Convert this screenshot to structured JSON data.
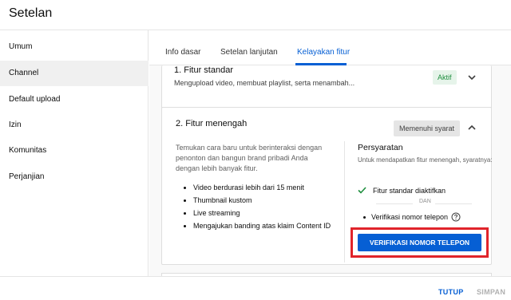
{
  "header": {
    "title": "Setelan"
  },
  "sidebar": {
    "items": [
      {
        "label": "Umum"
      },
      {
        "label": "Channel"
      },
      {
        "label": "Default upload"
      },
      {
        "label": "Izin"
      },
      {
        "label": "Komunitas"
      },
      {
        "label": "Perjanjian"
      }
    ],
    "active": "Channel"
  },
  "tabs": [
    {
      "label": "Info dasar"
    },
    {
      "label": "Setelan lanjutan"
    },
    {
      "label": "Kelayakan fitur"
    }
  ],
  "active_tab": "Kelayakan fitur",
  "card1": {
    "title": "1. Fitur standar",
    "subtitle": "Mengupload video, membuat playlist, serta menambah...",
    "badge": "Aktif"
  },
  "card2": {
    "title": "2. Fitur menengah",
    "badge": "Memenuhi syarat",
    "description": "Temukan cara baru untuk berinteraksi dengan penonton dan bangun brand pribadi Anda dengan lebih banyak fitur.",
    "features": [
      "Video berdurasi lebih dari 15 menit",
      "Thumbnail kustom",
      "Live streaming",
      "Mengajukan banding atas klaim Content ID"
    ],
    "requirements": {
      "title": "Persyaratan",
      "subtitle": "Untuk mendapatkan fitur menengah, syaratnya:",
      "check_item": "Fitur standar diaktifkan",
      "and_label": "DAN",
      "phone_item": "Verifikasi nomor telepon",
      "verify_button": "VERIFIKASI NOMOR TELEPON"
    }
  },
  "footer": {
    "close": "TUTUP",
    "save": "SIMPAN"
  },
  "colors": {
    "accent": "#065fd4",
    "success": "#1e8e3e",
    "highlight": "#e0242b"
  }
}
